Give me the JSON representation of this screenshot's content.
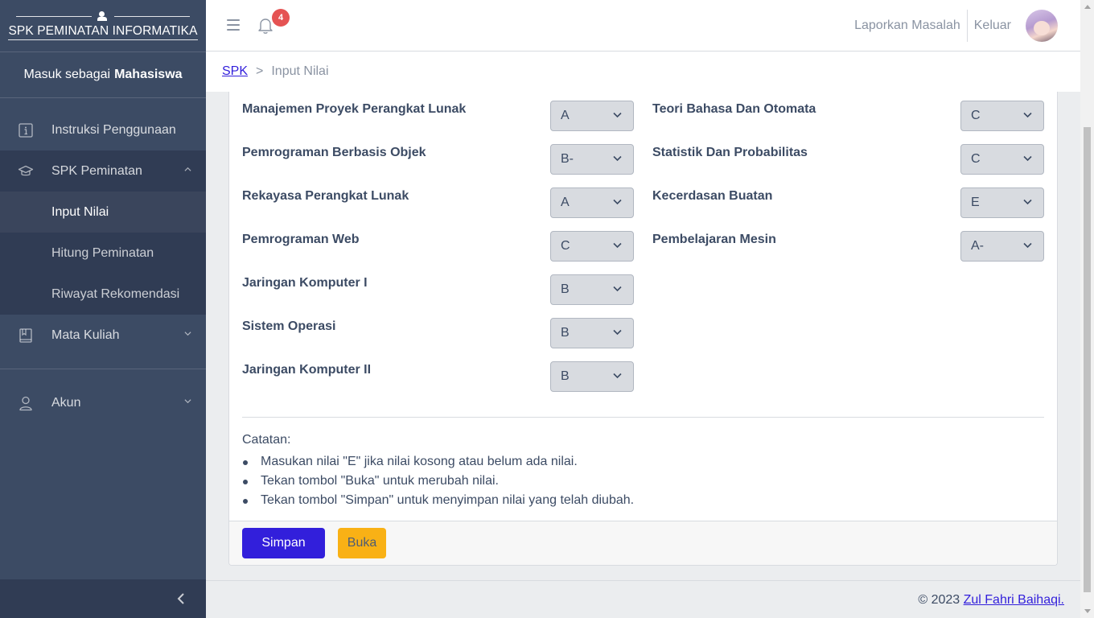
{
  "sidebar": {
    "brand": "SPK PEMINATAN INFORMATIKA",
    "login_prefix": "Masuk sebagai",
    "login_role": "Mahasiswa",
    "items": [
      {
        "label": "Instruksi Penggunaan",
        "icon": "info-icon"
      },
      {
        "label": "SPK Peminatan",
        "icon": "graduation-cap-icon",
        "expanded": true,
        "children": [
          {
            "label": "Input Nilai",
            "active": true
          },
          {
            "label": "Hitung Peminatan"
          },
          {
            "label": "Riwayat Rekomendasi"
          }
        ]
      },
      {
        "label": "Mata Kuliah",
        "icon": "book-icon"
      },
      {
        "label": "Akun",
        "icon": "user-icon"
      }
    ]
  },
  "header": {
    "notification_count": "4",
    "report_link": "Laporkan Masalah",
    "logout_link": "Keluar"
  },
  "breadcrumb": {
    "root": "SPK",
    "separator": ">",
    "current": "Input Nilai"
  },
  "grades": {
    "left": [
      {
        "course": "Manajemen Proyek Perangkat Lunak",
        "value": "A"
      },
      {
        "course": "Pemrograman Berbasis Objek",
        "value": "B-"
      },
      {
        "course": "Rekayasa Perangkat Lunak",
        "value": "A"
      },
      {
        "course": "Pemrograman Web",
        "value": "C"
      },
      {
        "course": "Jaringan Komputer I",
        "value": "B"
      },
      {
        "course": "Sistem Operasi",
        "value": "B"
      },
      {
        "course": "Jaringan Komputer II",
        "value": "B"
      }
    ],
    "right": [
      {
        "course": "Teori Bahasa Dan Otomata",
        "value": "C"
      },
      {
        "course": "Statistik Dan Probabilitas",
        "value": "C"
      },
      {
        "course": "Kecerdasan Buatan",
        "value": "E"
      },
      {
        "course": "Pembelajaran Mesin",
        "value": "A-"
      }
    ]
  },
  "notes": {
    "title": "Catatan:",
    "items": [
      "Masukan nilai \"E\" jika nilai kosong atau belum ada nilai.",
      "Tekan tombol \"Buka\" untuk merubah nilai.",
      "Tekan tombol \"Simpan\" untuk menyimpan nilai yang telah diubah."
    ]
  },
  "actions": {
    "save_label": "Simpan",
    "open_label": "Buka"
  },
  "footer": {
    "copyright": "© 2023",
    "author": "Zul Fahri Baihaqi."
  },
  "colors": {
    "sidebar_bg": "#3c4b64",
    "primary": "#321fdb",
    "warning": "#f9b115",
    "danger": "#e55353"
  }
}
